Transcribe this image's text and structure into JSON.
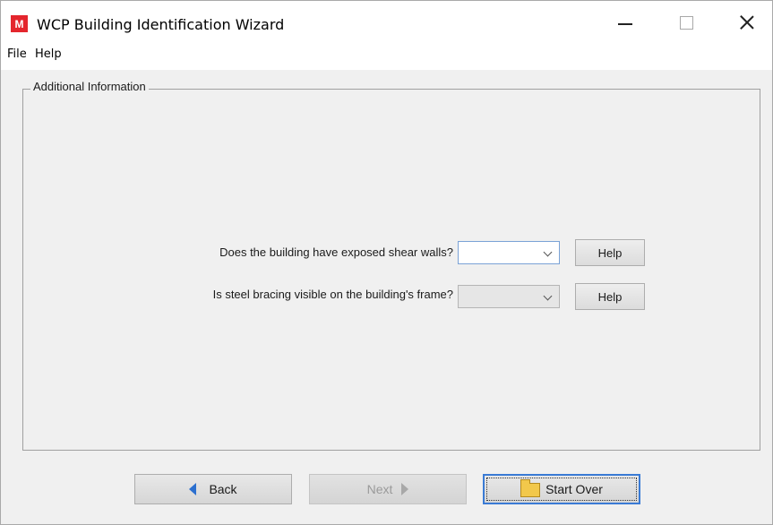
{
  "window": {
    "title": "WCP Building Identification Wizard",
    "app_icon_glyph": "M"
  },
  "menu": {
    "file": "File",
    "help": "Help"
  },
  "panel": {
    "title": "Additional Information"
  },
  "questions": [
    {
      "label": "Does the building have exposed shear walls?",
      "value": "",
      "help_label": "Help"
    },
    {
      "label": "Is steel bracing visible on the building's frame?",
      "value": "",
      "help_label": "Help"
    }
  ],
  "buttons": {
    "back": "Back",
    "next": "Next",
    "start_over": "Start Over"
  },
  "icons": {
    "app": "wizard-app-icon",
    "back": "arrow-left-icon",
    "next": "arrow-right-icon",
    "start_over": "folder-icon"
  },
  "colors": {
    "accent": "#3a7bd5",
    "app_icon": "#e4262d"
  }
}
